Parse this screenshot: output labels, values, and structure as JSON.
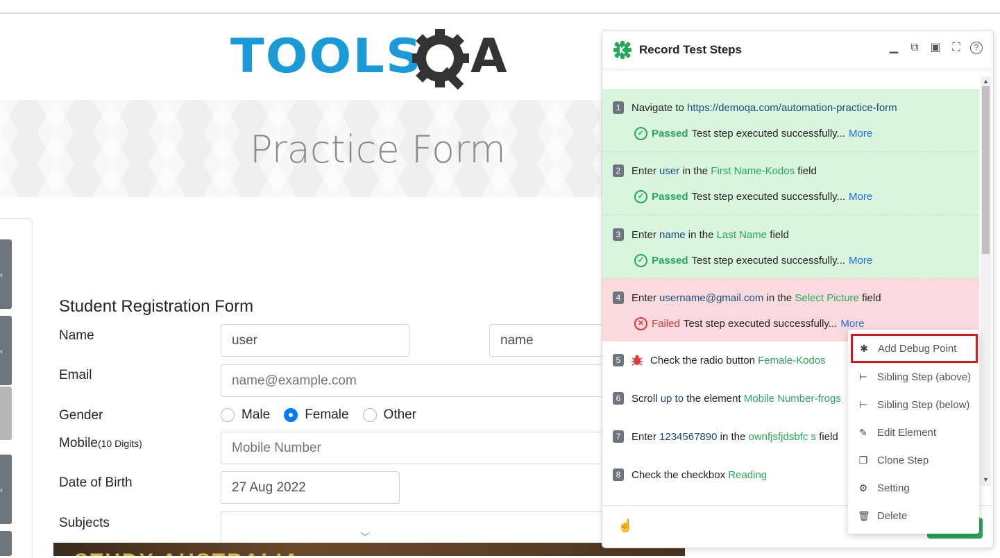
{
  "page": {
    "logo_text": "TOOLS",
    "logo_a": "A",
    "banner_title": "Practice Form",
    "form_title": "Student Registration Form",
    "labels": {
      "name": "Name",
      "email": "Email",
      "gender": "Gender",
      "mobile": "Mobile",
      "mobile_hint": "(10 Digits)",
      "dob": "Date of Birth",
      "subjects": "Subjects"
    },
    "first_name_value": "user",
    "last_name_value": "name",
    "email_placeholder": "name@example.com",
    "mobile_placeholder": "Mobile Number",
    "dob_value": "27 Aug 2022",
    "gender_options": [
      "Male",
      "Female",
      "Other"
    ],
    "gender_selected": "Female",
    "ad_text": "STUDY AUSTRALIA",
    "colors": {
      "brand_blue": "#1a9ad6",
      "radio_blue": "#007bff"
    }
  },
  "panel": {
    "title": "Record Test Steps",
    "header_icons": [
      "minimize-icon",
      "dock-icon",
      "window-icon",
      "fullscreen-icon",
      "help-icon"
    ],
    "steps": [
      {
        "num": "1",
        "parts": [
          "Navigate to ",
          "https://demoqa.com/automation-practice-form"
        ],
        "status": "Passed",
        "message": "Test step executed successfully...",
        "more": "More"
      },
      {
        "num": "2",
        "parts": [
          "Enter ",
          "user",
          " in the ",
          "First Name-Kodos",
          " field"
        ],
        "status": "Passed",
        "message": "Test step executed successfully...",
        "more": "More"
      },
      {
        "num": "3",
        "parts": [
          "Enter ",
          "name",
          " in the ",
          "Last Name",
          " field"
        ],
        "status": "Passed",
        "message": "Test step executed successfully...",
        "more": "More"
      },
      {
        "num": "4",
        "parts": [
          "Enter ",
          "username@gmail.com",
          " in the ",
          "Select Picture",
          " field"
        ],
        "status": "Failed",
        "message": "Test step executed successfully...",
        "more": "More"
      },
      {
        "num": "5",
        "parts": [
          "Check the radio button ",
          "Female-Kodos"
        ]
      },
      {
        "num": "6",
        "parts": [
          "Scroll ",
          "up to",
          " the element ",
          "Mobile Number-frogs"
        ]
      },
      {
        "num": "7",
        "parts": [
          "Enter ",
          "1234567890",
          " in the ",
          "ownfjsfjdsbfc s",
          " field"
        ]
      },
      {
        "num": "8",
        "parts": [
          "Check the checkbox ",
          "Reading"
        ]
      }
    ],
    "colors": {
      "pass_bg": "#d9f5dd",
      "fail_bg": "#fadadd",
      "pass_text": "#27a75a",
      "fail_text": "#d9363e",
      "link": "#1e6fd9"
    }
  },
  "context_menu": {
    "items": [
      {
        "label": "Add Debug Point",
        "icon": "bug-icon"
      },
      {
        "label": "Sibling Step (above)",
        "icon": "sibling-above-icon"
      },
      {
        "label": "Sibling Step (below)",
        "icon": "sibling-below-icon"
      },
      {
        "label": "Edit Element",
        "icon": "edit-icon"
      },
      {
        "label": "Clone Step",
        "icon": "clone-icon"
      },
      {
        "label": "Setting",
        "icon": "gear-icon"
      },
      {
        "label": "Delete",
        "icon": "trash-icon"
      }
    ],
    "highlight_color": "#e0141b"
  }
}
